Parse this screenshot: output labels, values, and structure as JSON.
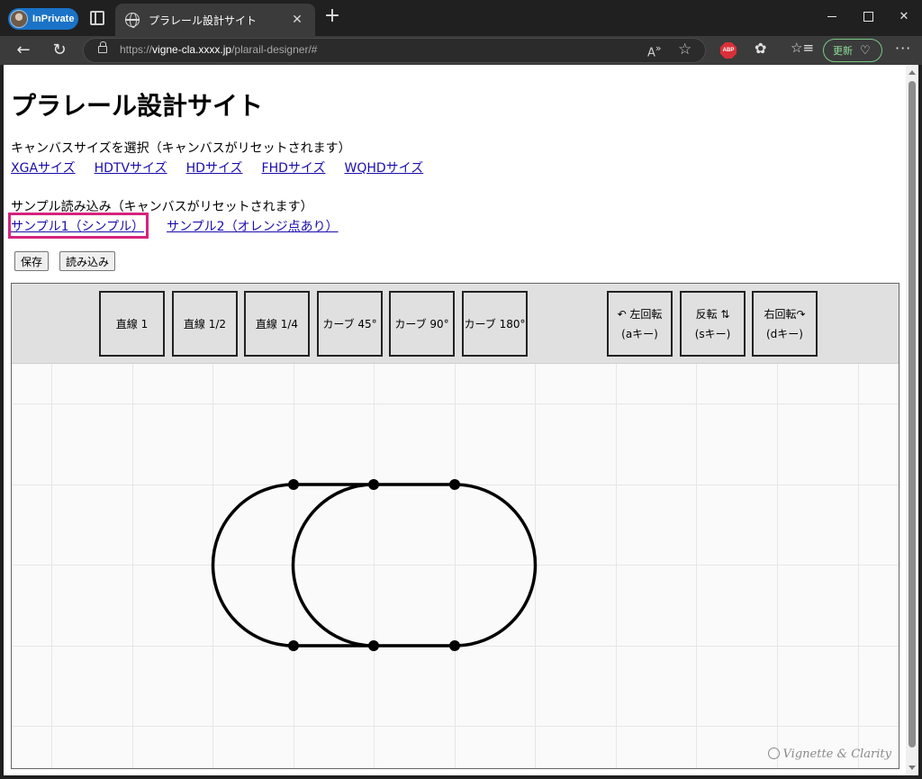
{
  "browser": {
    "inprivate_label": "InPrivate",
    "tab_title": "プラレール設計サイト",
    "tab_close": "✕",
    "new_tab": "+",
    "url_prefix": "https://",
    "url_host": "vigne-cla.xxxx.jp",
    "url_path": "/plarail-designer/#",
    "update_label": "更新",
    "window_close": "✕"
  },
  "page": {
    "title": "プラレール設計サイト",
    "canvas_size_label": "キャンバスサイズを選択（キャンバスがリセットされます）",
    "canvas_sizes": [
      "XGAサイズ",
      "HDTVサイズ",
      "HDサイズ",
      "FHDサイズ",
      "WQHDサイズ"
    ],
    "sample_label": "サンプル読み込み（キャンバスがリセットされます）",
    "samples": [
      "サンプル1（シンプル）",
      "サンプル2（オレンジ点あり）"
    ],
    "save_button": "保存",
    "load_button": "読み込み"
  },
  "palette": {
    "pieces": [
      "直線 1",
      "直線 1/2",
      "直線 1/4",
      "カーブ 45°",
      "カーブ 90°",
      "カーブ 180°"
    ],
    "actions": [
      {
        "label": "↶ 左回転",
        "key": "(aキー)"
      },
      {
        "label": "反転 ⇅",
        "key": "(sキー)"
      },
      {
        "label": "右回転↷",
        "key": "(dキー)"
      }
    ]
  },
  "canvas": {
    "grid_color": "#e6e6e6",
    "track_color": "#000000",
    "background": "#fafafa"
  },
  "watermark": "Vignette & Clarity"
}
